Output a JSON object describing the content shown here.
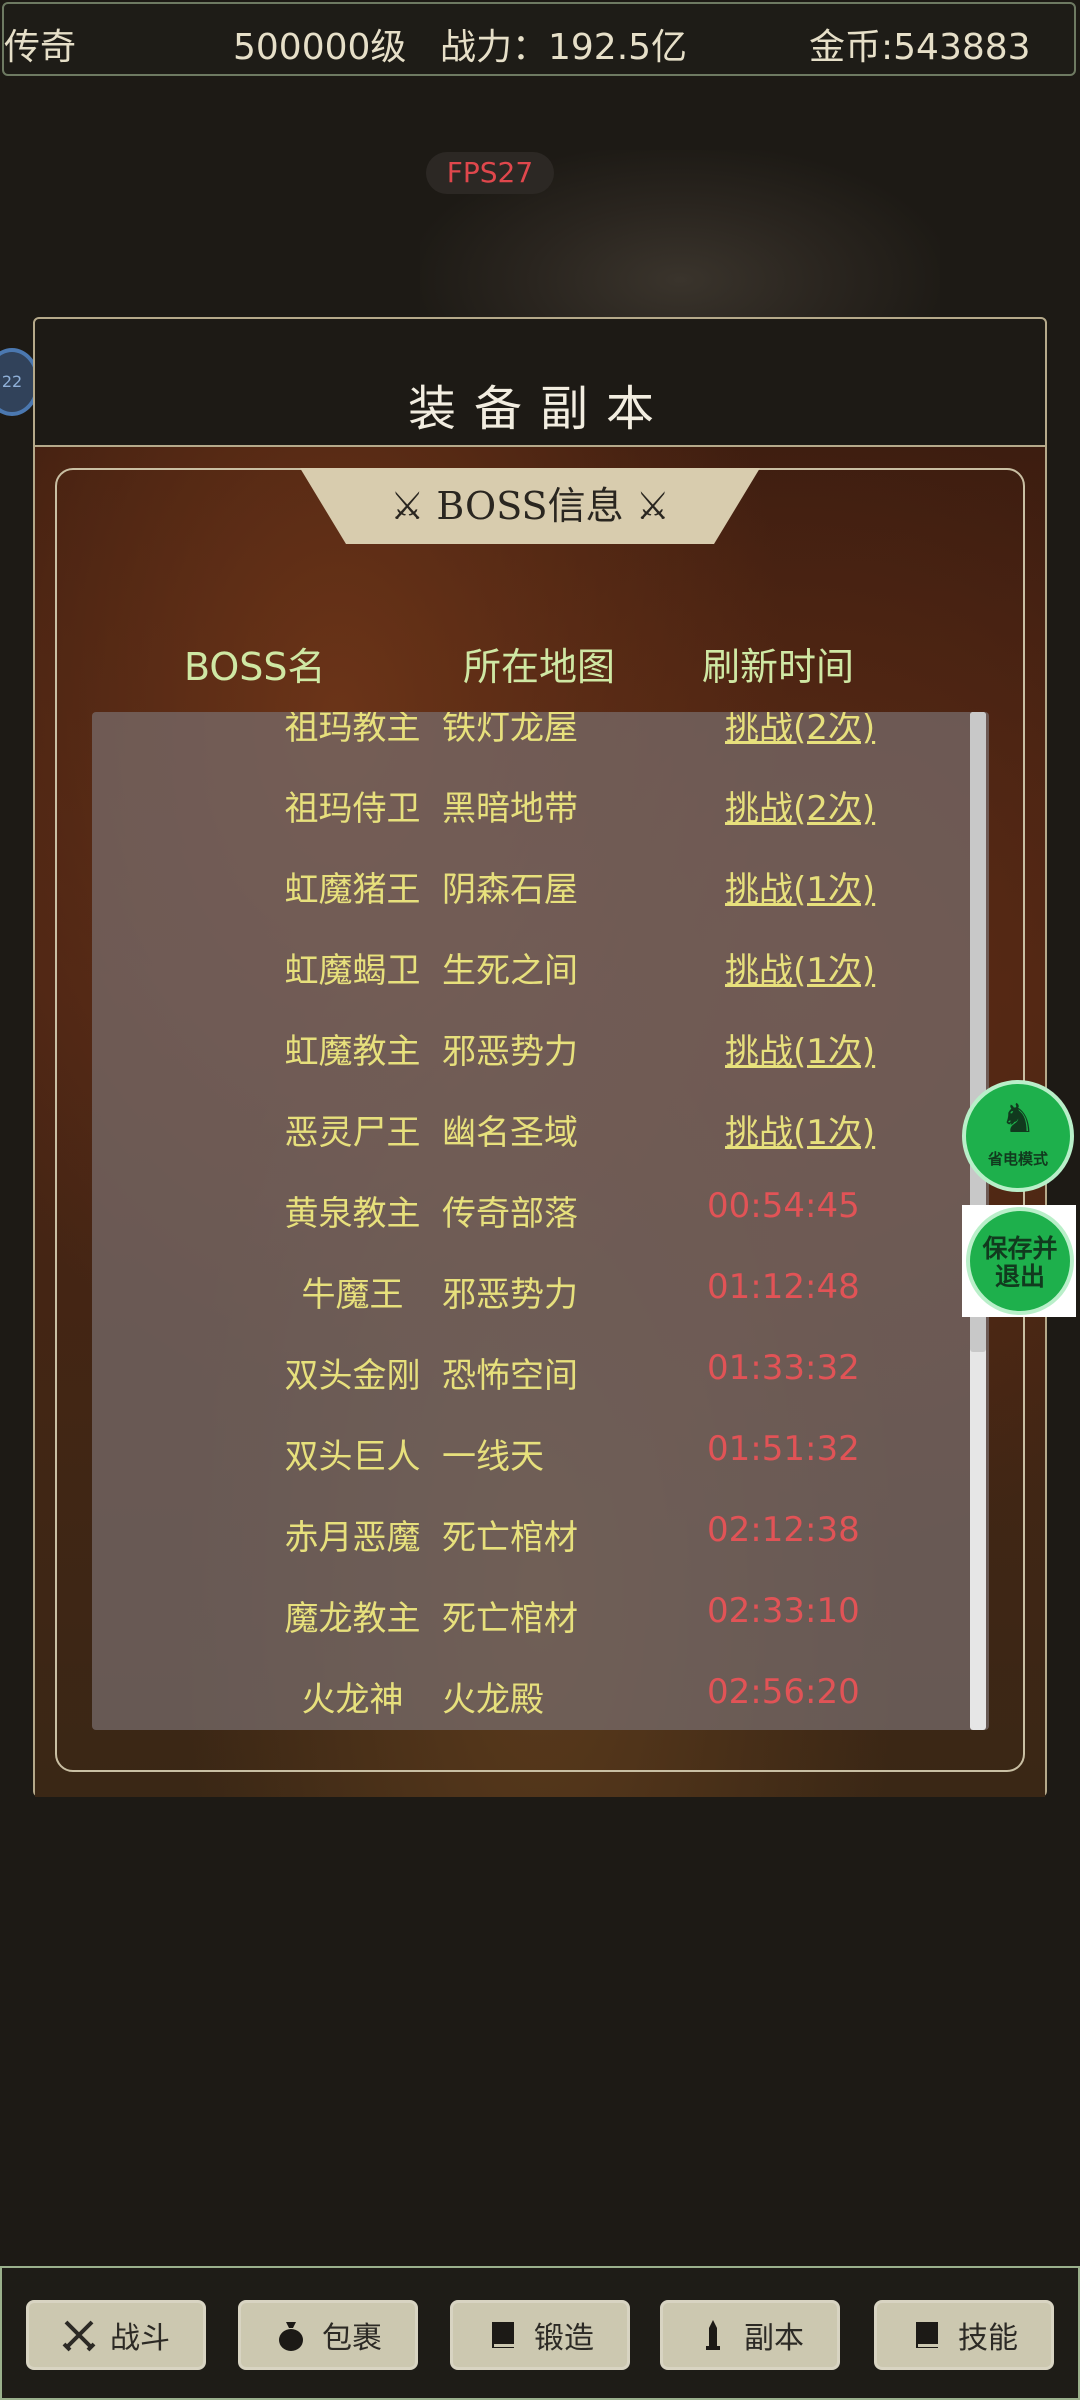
{
  "topbar": {
    "title": "传奇",
    "level": "500000级",
    "power": "战力：192.5亿",
    "gold": "金币:543883"
  },
  "fps": "FPS27",
  "left_badge": "22",
  "panel": {
    "title": "装备副本",
    "tab_label": "BOSS信息"
  },
  "columns": [
    "BOSS名",
    "所在地图",
    "刷新时间"
  ],
  "rows": [
    {
      "name": "祖玛教主",
      "map": "铁灯龙屋",
      "status": "挑战(2次)",
      "type": "challenge"
    },
    {
      "name": "祖玛侍卫",
      "map": "黑暗地带",
      "status": "挑战(2次)",
      "type": "challenge"
    },
    {
      "name": "虹魔猪王",
      "map": "阴森石屋",
      "status": "挑战(1次)",
      "type": "challenge"
    },
    {
      "name": "虹魔蝎卫",
      "map": "生死之间",
      "status": "挑战(1次)",
      "type": "challenge"
    },
    {
      "name": "虹魔教主",
      "map": "邪恶势力",
      "status": "挑战(1次)",
      "type": "challenge"
    },
    {
      "name": "恶灵尸王",
      "map": "幽名圣域",
      "status": "挑战(1次)",
      "type": "challenge"
    },
    {
      "name": "黄泉教主",
      "map": "传奇部落",
      "status": "00:54:45",
      "type": "timer"
    },
    {
      "name": "牛魔王",
      "map": "邪恶势力",
      "status": "01:12:48",
      "type": "timer"
    },
    {
      "name": "双头金刚",
      "map": "恐怖空间",
      "status": "01:33:32",
      "type": "timer"
    },
    {
      "name": "双头巨人",
      "map": "一线天",
      "status": "01:51:32",
      "type": "timer"
    },
    {
      "name": "赤月恶魔",
      "map": "死亡棺材",
      "status": "02:12:38",
      "type": "timer"
    },
    {
      "name": "魔龙教主",
      "map": "死亡棺材",
      "status": "02:33:10",
      "type": "timer"
    },
    {
      "name": "火龙神",
      "map": "火龙殿",
      "status": "02:56:20",
      "type": "timer"
    }
  ],
  "scroll_position": 0.6,
  "float": {
    "power_mode": "省电模式",
    "save_exit_line1": "保存并",
    "save_exit_line2": "退出"
  },
  "nav": [
    {
      "label": "战斗",
      "icon": "crossed-swords-icon"
    },
    {
      "label": "包裹",
      "icon": "bag-icon"
    },
    {
      "label": "锻造",
      "icon": "book-icon"
    },
    {
      "label": "副本",
      "icon": "tower-icon"
    },
    {
      "label": "技能",
      "icon": "book-icon"
    }
  ],
  "colors": {
    "background": "#1d1a15",
    "header_text": "#cfe8a4",
    "row_text": "#e7e07c",
    "timer_text": "#e15356",
    "float_green": "#1eb04c"
  }
}
